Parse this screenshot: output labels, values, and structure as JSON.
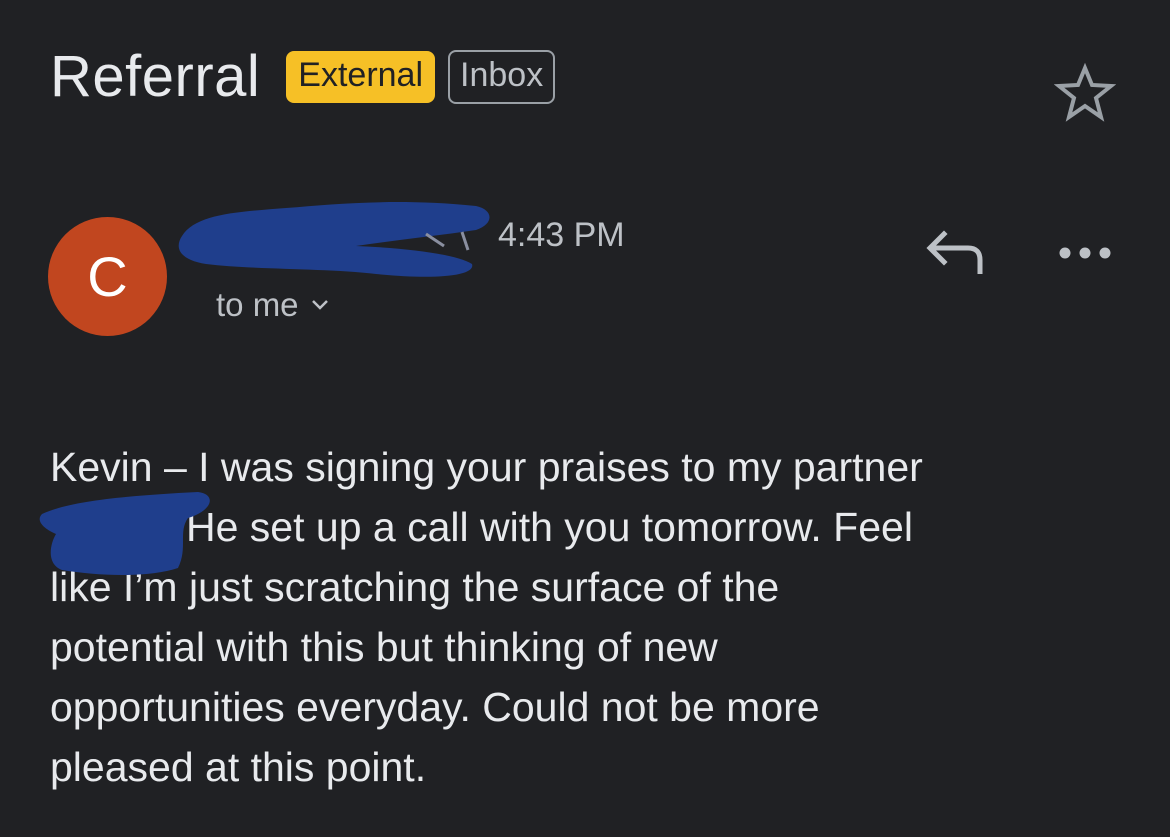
{
  "email": {
    "subject": "Referral",
    "labels": {
      "external": "External",
      "inbox": "Inbox"
    },
    "sender": {
      "avatar_initial": "C",
      "avatar_color": "#c1461f",
      "time": "4:43 PM",
      "recipient_text": "to me"
    },
    "body_lines": [
      "Kevin – I was signing your praises to my partner",
      "He set up a call with you tomorrow.  Feel",
      "like I’m just scratching the surface of the",
      "potential with this but thinking of new",
      "opportunities everyday. Could not be more",
      "pleased at this point."
    ]
  },
  "icons": {
    "star": "star-icon",
    "reply": "reply-icon",
    "more": "more-options-icon",
    "chevron": "chevron-down-icon"
  },
  "colors": {
    "background": "#202124",
    "external_chip": "#f6c026",
    "redaction": "#1f3e8c"
  }
}
